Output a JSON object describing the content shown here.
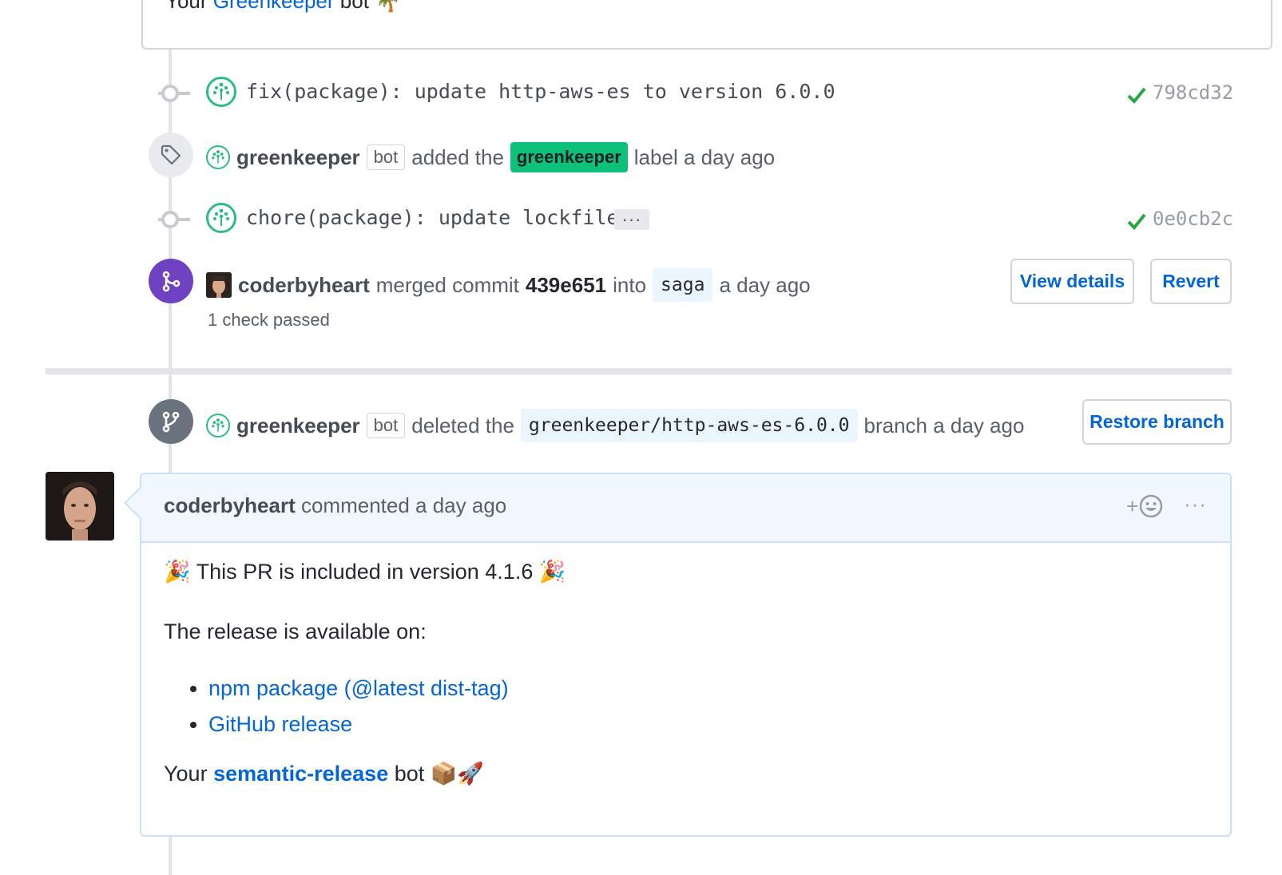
{
  "top_comment": {
    "prefix": "Your",
    "link": "Greenkeeper",
    "suffix": "bot",
    "emoji": "🌴"
  },
  "timeline": {
    "commit1": {
      "message": "fix(package): update http-aws-es to version 6.0.0",
      "sha": "798cd32",
      "status": "check"
    },
    "label_event": {
      "author": "greenkeeper",
      "bot": "bot",
      "action": "added the",
      "label": "greenkeeper",
      "suffix": "label a day ago"
    },
    "commit2": {
      "message": "chore(package): update lockfile",
      "more": "···",
      "sha": "0e0cb2c",
      "status": "check"
    },
    "merge_event": {
      "author": "coderbyheart",
      "action": "merged commit",
      "commit": "439e651",
      "into": "into",
      "branch": "saga",
      "time": "a day ago",
      "checks": "1 check passed",
      "view_details": "View details",
      "revert": "Revert"
    },
    "delete_event": {
      "author": "greenkeeper",
      "bot": "bot",
      "action": "deleted the",
      "branch": "greenkeeper/http-aws-es-6.0.0",
      "suffix": "branch a day ago",
      "restore": "Restore branch"
    }
  },
  "comment": {
    "author": "coderbyheart",
    "meta": "commented a day ago",
    "reaction_plus": "+",
    "more": "···",
    "body": {
      "line1_emoji_left": "🎉",
      "line1": "This PR is included in version 4.1.6",
      "line1_emoji_right": "🎉",
      "line2": "The release is available on:",
      "links": [
        "npm package (@latest dist-tag)",
        "GitHub release"
      ],
      "sign_prefix": "Your",
      "sign_link": "semantic-release",
      "sign_suffix": "bot",
      "sign_emoji": "📦🚀"
    }
  },
  "colors": {
    "link": "#0366d6",
    "greenkeeper_label": "#0ec17a",
    "merge_purple": "#6f42c1",
    "check_green": "#28a745"
  }
}
